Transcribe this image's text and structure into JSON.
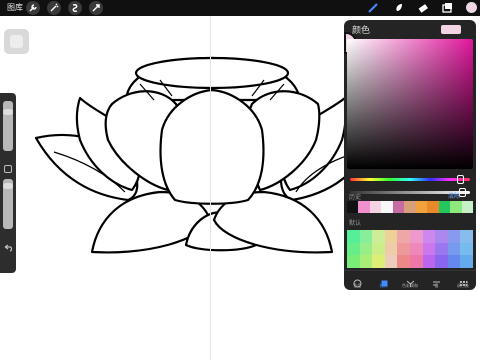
{
  "topbar": {
    "gallery_label": "图库",
    "left_tools": [
      "wrench-icon",
      "magic-wand-icon",
      "selection-icon",
      "transform-arrow-icon"
    ],
    "right_tools": [
      "brush-icon",
      "smudge-icon",
      "eraser-icon",
      "layers-icon"
    ],
    "active_color": "#f4d3e4"
  },
  "color_panel": {
    "title": "颜色",
    "history_label": "历史",
    "clear_label": "清除",
    "palette_label": "默认",
    "history_colors": [
      "#111111",
      "#f28fcf",
      "#f4d3e4",
      "#f7f7f7",
      "#c86aa3",
      "#d7a07a",
      "#f0a33a",
      "#e98a2a",
      "#25c65d",
      "#8de87d",
      "#c6f0c6"
    ],
    "palette_colors": [
      "#55ee99",
      "#88ee99",
      "#ccee99",
      "#eed199",
      "#eea6a6",
      "#ee99cc",
      "#cc88ee",
      "#aa88ee",
      "#8899ee",
      "#88bbee",
      "#66ee88",
      "#99ee88",
      "#ccee88",
      "#eeccaa",
      "#ee9999",
      "#ee88bb",
      "#cc77ee",
      "#9977ee",
      "#7799ee",
      "#77bbee",
      "#77ee77",
      "#aaee77",
      "#ddee77",
      "#eeccbb",
      "#ee8888",
      "#ee77aa",
      "#bb66ee",
      "#8866ee",
      "#6688ee",
      "#66aaee"
    ],
    "tabs": [
      {
        "label": "色盘",
        "icon": "disc-icon"
      },
      {
        "label": "经典",
        "icon": "classic-square-icon"
      },
      {
        "label": "色彩调和",
        "icon": "harmony-icon"
      },
      {
        "label": "值",
        "icon": "sliders-icon"
      },
      {
        "label": "调色板",
        "icon": "palette-grid-icon"
      }
    ],
    "active_tab": "经典"
  }
}
